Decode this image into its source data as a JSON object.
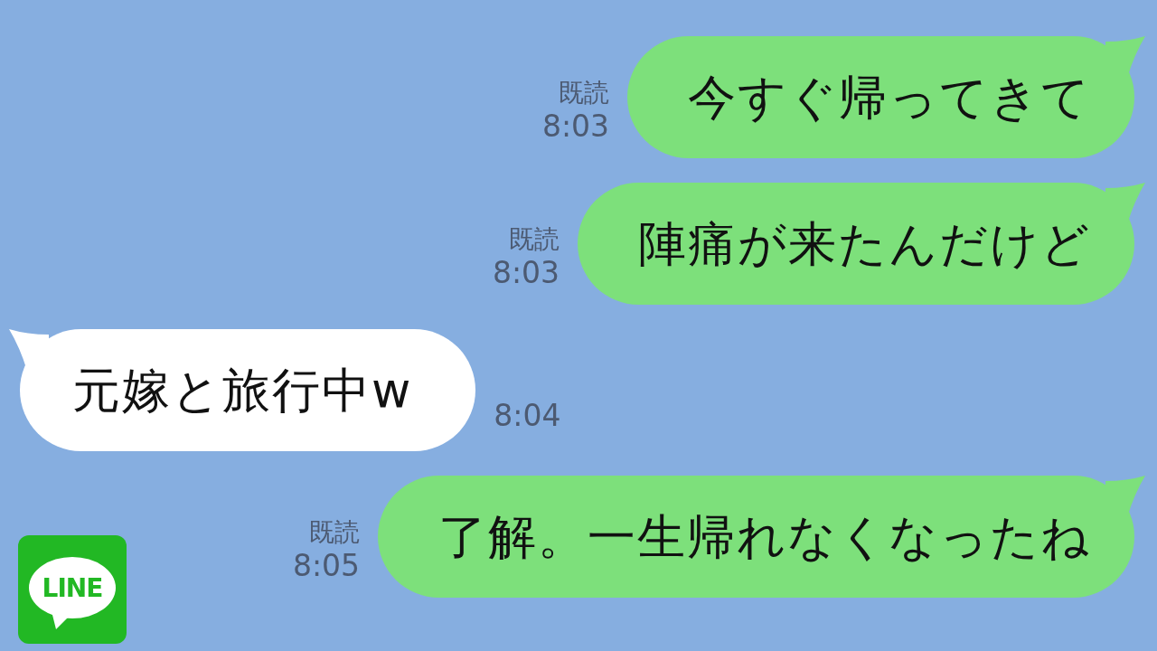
{
  "messages": [
    {
      "kind": "sent",
      "text": "今すぐ帰ってきて",
      "read_receipt": "既読",
      "time": "8:03"
    },
    {
      "kind": "sent",
      "text": "陣痛が来たんだけど",
      "read_receipt": "既読",
      "time": "8:03"
    },
    {
      "kind": "received",
      "text": "元嫁と旅行中w",
      "time": "8:04"
    },
    {
      "kind": "sent",
      "text": "了解。一生帰れなくなったね",
      "read_receipt": "既読",
      "time": "8:05"
    }
  ],
  "app_logo": {
    "label": "LINE"
  }
}
